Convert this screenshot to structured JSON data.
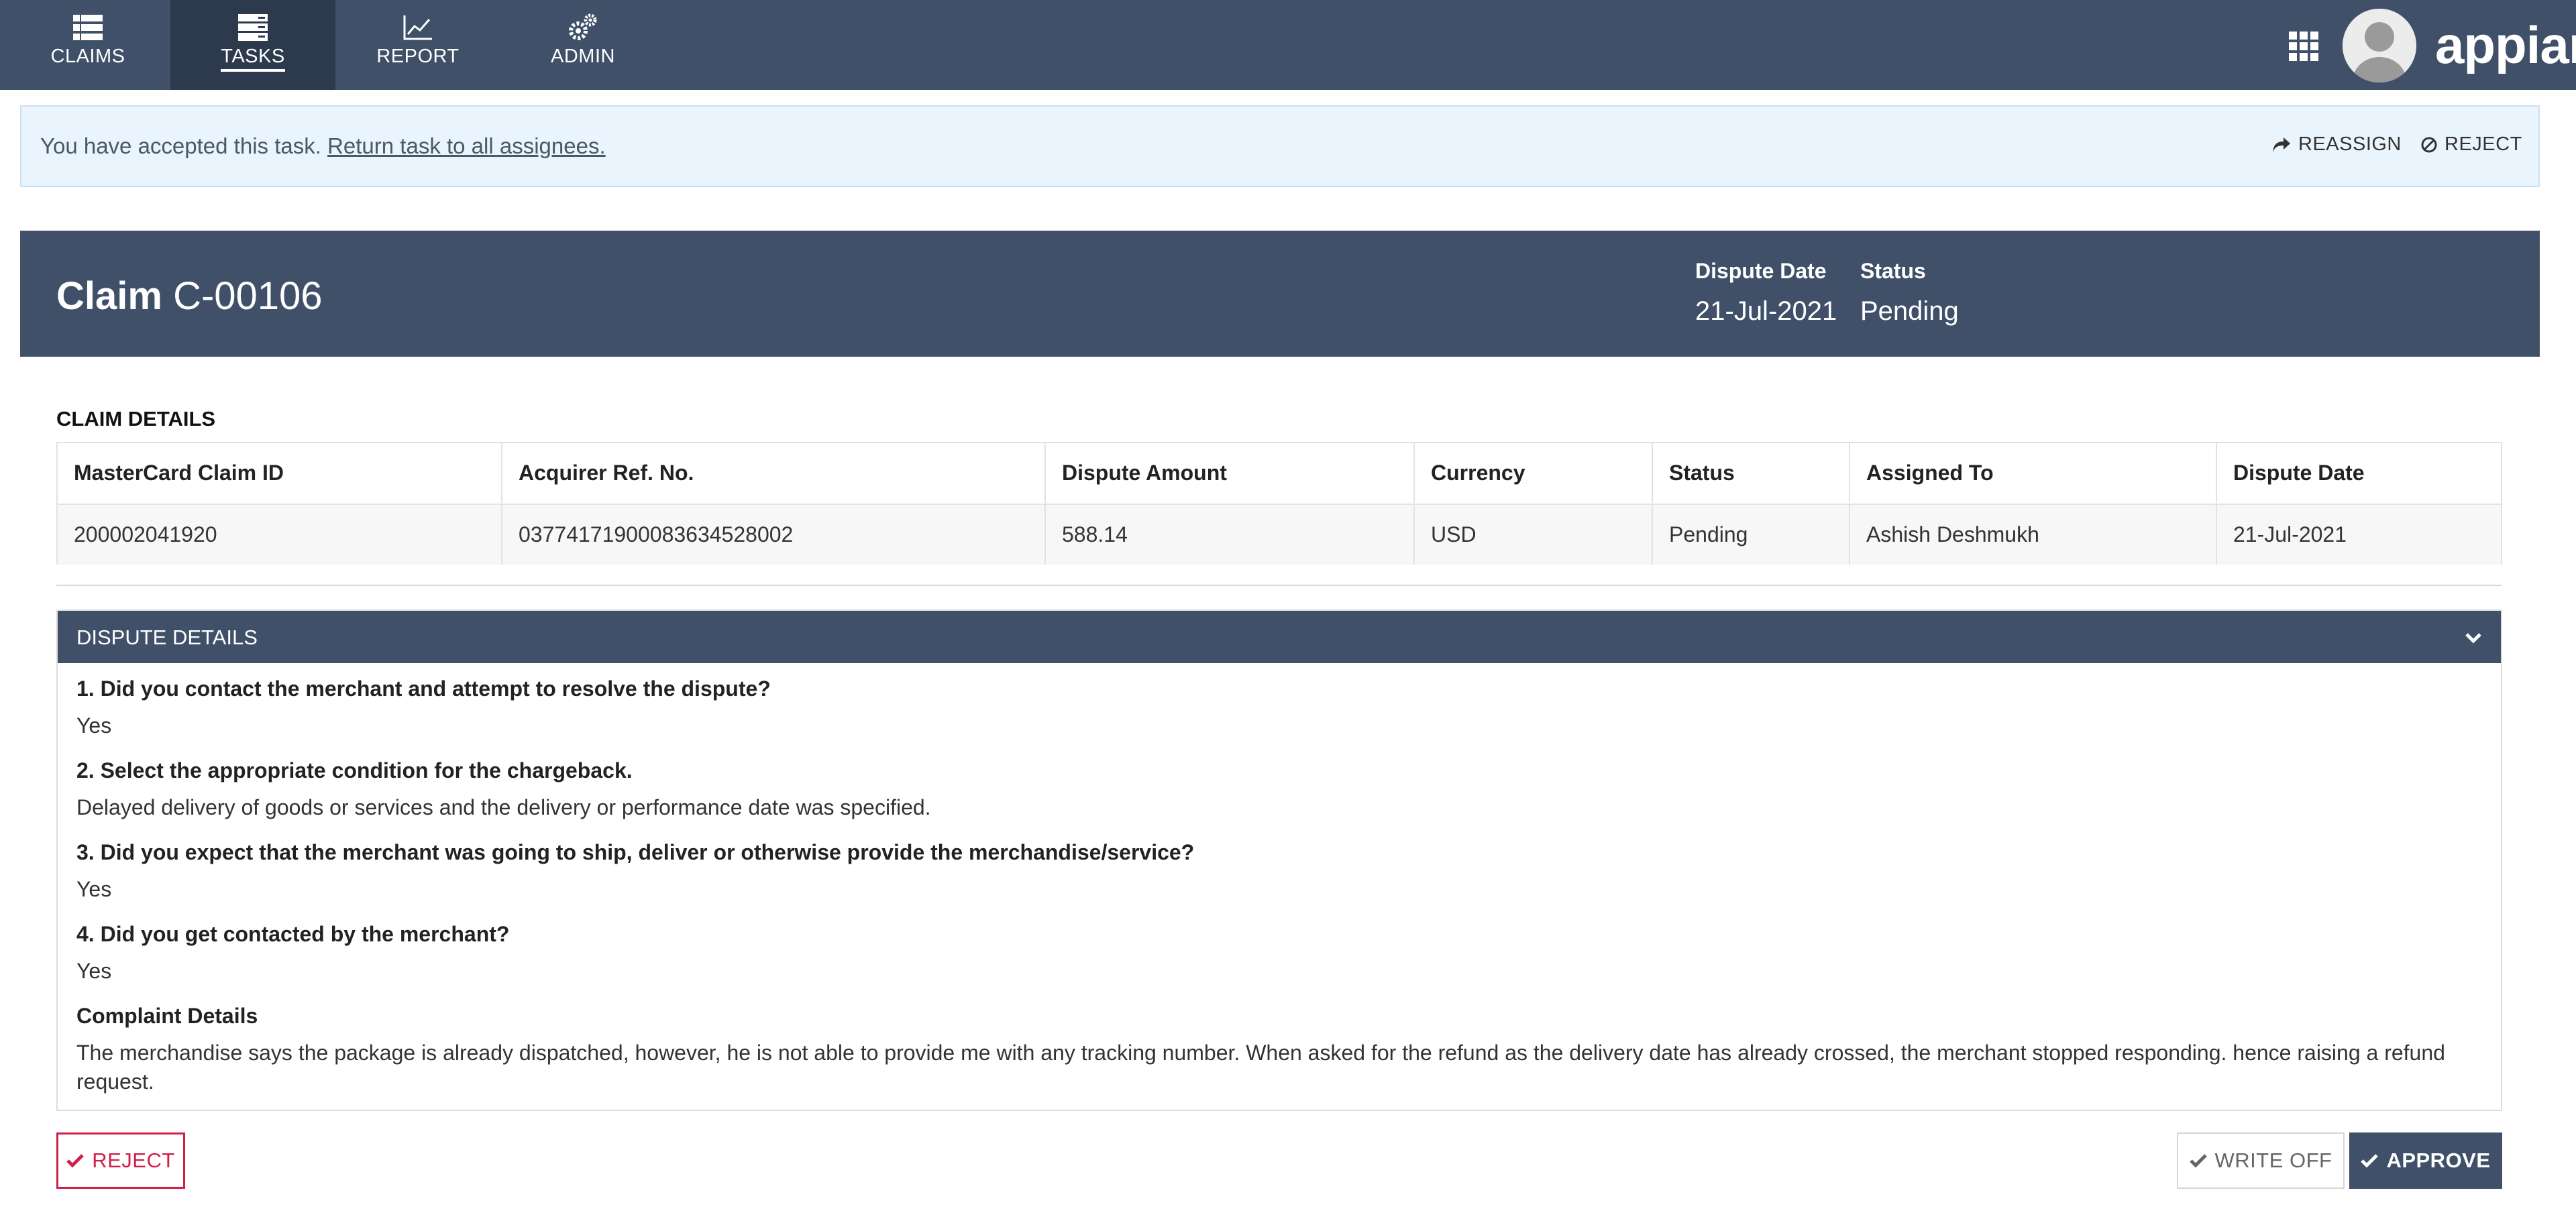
{
  "nav": {
    "tabs": [
      {
        "label": "CLAIMS",
        "icon": "list-icon"
      },
      {
        "label": "TASKS",
        "icon": "tasks-icon",
        "active": true
      },
      {
        "label": "REPORT",
        "icon": "line-chart-icon"
      },
      {
        "label": "ADMIN",
        "icon": "gears-icon"
      }
    ],
    "logo": "appian"
  },
  "banner": {
    "message": "You have accepted this task.",
    "link": "Return task to all assignees.",
    "reassign": "REASSIGN",
    "reject": "REJECT"
  },
  "claim": {
    "title_prefix": "Claim",
    "id": "C-00106",
    "dispute_date_label": "Dispute Date",
    "dispute_date": "21-Jul-2021",
    "status_label": "Status",
    "status": "Pending"
  },
  "claim_details": {
    "label": "CLAIM DETAILS",
    "columns": [
      "MasterCard Claim ID",
      "Acquirer Ref. No.",
      "Dispute Amount",
      "Currency",
      "Status",
      "Assigned To",
      "Dispute Date"
    ],
    "row": [
      "200002041920",
      "0377417190008363452800​2",
      "588.14",
      "USD",
      "Pending",
      "Ashish Deshmukh",
      "21-Jul-2021"
    ]
  },
  "dispute_details": {
    "label": "DISPUTE DETAILS",
    "items": [
      {
        "q": "1. Did you contact the merchant and attempt to resolve the dispute?",
        "a": "Yes"
      },
      {
        "q": "2. Select the appropriate condition for the chargeback.",
        "a": "Delayed delivery of goods or services and the delivery or performance date was specified."
      },
      {
        "q": "3. Did you expect that the merchant was going to ship, deliver or otherwise provide the merchandise/service?",
        "a": "Yes"
      },
      {
        "q": "4. Did you get contacted by the merchant?",
        "a": "Yes"
      },
      {
        "q": "Complaint Details",
        "a": "The merchandise says the package is already dispatched, however, he is not able to provide me with any tracking number. When asked for the refund as the delivery date has already crossed, the merchant stopped responding. hence raising a refund request."
      }
    ]
  },
  "actions": {
    "reject": "REJECT",
    "write_off": "WRITE OFF",
    "approve": "APPROVE"
  },
  "colors": {
    "nav_bg": "#3f5068",
    "nav_active": "#2d3a4d",
    "banner_bg": "#eaf4fd",
    "reject": "#d0204a"
  }
}
